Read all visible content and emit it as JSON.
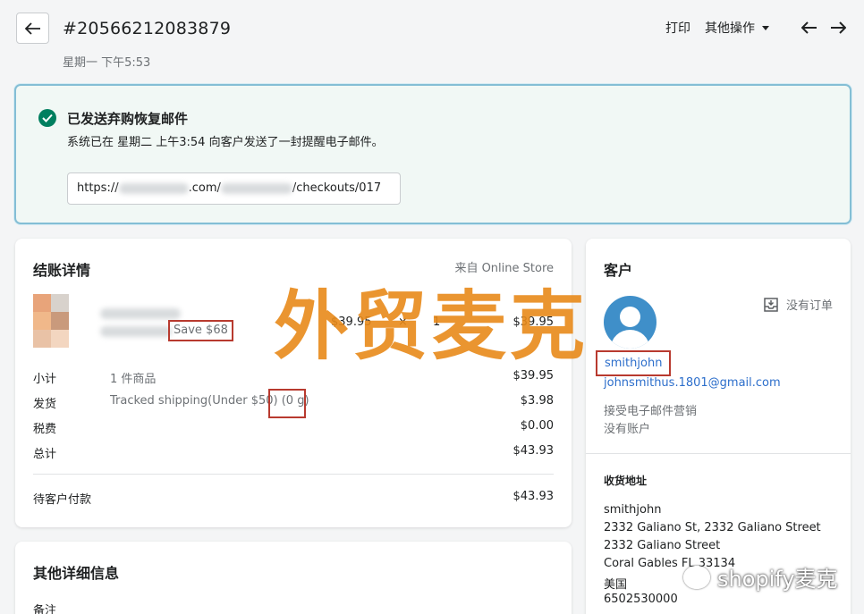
{
  "header": {
    "order_number": "#20566212083879",
    "timestamp": "星期一 下午5:53",
    "print_label": "打印",
    "more_actions_label": "其他操作"
  },
  "banner": {
    "title": "已发送弃购恢复邮件",
    "message": "系统已在 星期二 上午3:54 向客户发送了一封提醒电子邮件。",
    "url_prefix": "https://",
    "url_mid": ".com/",
    "url_suffix": "/checkouts/017"
  },
  "checkout": {
    "title": "结账详情",
    "source": "来自 Online Store",
    "product": {
      "save_label": "Save $68",
      "price": "$39.95",
      "multiply": "×",
      "quantity": "1",
      "total": "$39.95"
    },
    "summary": [
      {
        "label": "小计",
        "desc": "1 件商品",
        "value": "$39.95"
      },
      {
        "label": "发货",
        "desc": "Tracked shipping(Under $50) (0 g)",
        "value": "$3.98"
      },
      {
        "label": "税费",
        "desc": "",
        "value": "$0.00"
      },
      {
        "label": "总计",
        "desc": "",
        "value": "$43.93"
      }
    ],
    "due": {
      "label": "待客户付款",
      "value": "$43.93"
    }
  },
  "other": {
    "title": "其他详细信息",
    "notes_label": "备注"
  },
  "customer": {
    "title": "客户",
    "no_orders": "没有订单",
    "name": "smithjohn",
    "email": "johnsmithus.1801@gmail.com",
    "marketing": "接受电子邮件营销",
    "account": "没有账户",
    "address_title": "收货地址",
    "address": [
      "smithjohn",
      "2332 Galiano St, 2332 Galiano Street",
      "2332 Galiano Street",
      "Coral Gables FL 33134",
      "美国",
      "6502530000"
    ]
  },
  "watermarks": {
    "main": "外贸麦克",
    "corner": "shopify麦克"
  },
  "colors": {
    "success_green": "#007f5f",
    "link_blue": "#2c6ecb",
    "highlight_red": "#b83a2f",
    "watermark_orange": "#e88a1a"
  }
}
